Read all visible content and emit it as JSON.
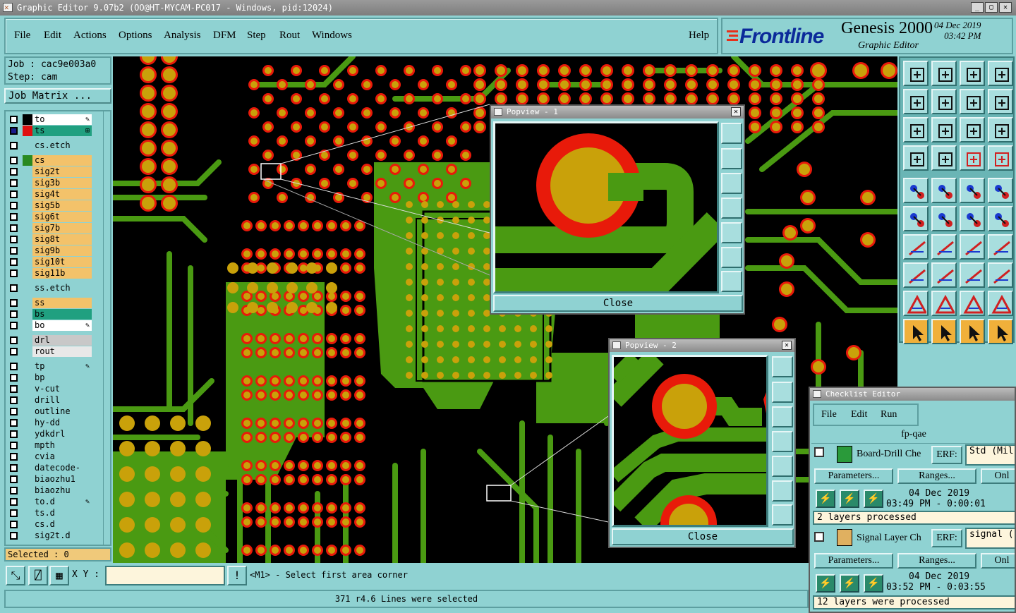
{
  "window": {
    "title": "Graphic Editor 9.07b2 (OO@HT-MYCAM-PC017 - Windows, pid:12024)"
  },
  "menu": [
    "File",
    "Edit",
    "Actions",
    "Options",
    "Analysis",
    "DFM",
    "Step",
    "Rout",
    "Windows"
  ],
  "help": "Help",
  "brand": {
    "logo": "Frontline",
    "product": "Genesis 2000",
    "subtitle": "Graphic Editor",
    "date": "04 Dec 2019",
    "time": "03:42 PM"
  },
  "job": {
    "job": "Job : cac9e003a0",
    "step": "Step: cam",
    "matrix_btn": "Job Matrix ..."
  },
  "layers": [
    {
      "name": "to",
      "color": "#ffffff",
      "swatch": "#000000",
      "mark": "✎"
    },
    {
      "name": "ts",
      "color": "#20a080",
      "swatch": "#e01010",
      "mark": "⊞",
      "checked": true
    },
    {
      "name": "cs.etch",
      "color": "#8fd2d2"
    },
    {
      "name": "cs",
      "color": "#f3c26a",
      "swatch": "#2a8a20"
    },
    {
      "name": "sig2t",
      "color": "#f3c26a"
    },
    {
      "name": "sig3b",
      "color": "#f3c26a"
    },
    {
      "name": "sig4t",
      "color": "#f3c26a"
    },
    {
      "name": "sig5b",
      "color": "#f3c26a"
    },
    {
      "name": "sig6t",
      "color": "#f3c26a"
    },
    {
      "name": "sig7b",
      "color": "#f3c26a"
    },
    {
      "name": "sig8t",
      "color": "#f3c26a"
    },
    {
      "name": "sig9b",
      "color": "#f3c26a"
    },
    {
      "name": "sig10t",
      "color": "#f3c26a"
    },
    {
      "name": "sig11b",
      "color": "#f3c26a"
    },
    {
      "name": "ss.etch",
      "color": "#8fd2d2"
    },
    {
      "name": "ss",
      "color": "#f3c26a"
    },
    {
      "name": "bs",
      "color": "#20a080"
    },
    {
      "name": "bo",
      "color": "#ffffff",
      "mark": "✎"
    },
    {
      "name": "drl",
      "color": "#c8c8c8"
    },
    {
      "name": "rout",
      "color": "#e8e8e8"
    },
    {
      "name": "tp",
      "color": "#8fd2d2",
      "mark": "✎"
    },
    {
      "name": "bp",
      "color": "#8fd2d2"
    },
    {
      "name": "v-cut",
      "color": "#8fd2d2"
    },
    {
      "name": "drill",
      "color": "#8fd2d2"
    },
    {
      "name": "outline",
      "color": "#8fd2d2"
    },
    {
      "name": "hy-dd",
      "color": "#8fd2d2"
    },
    {
      "name": "ydkdrl",
      "color": "#8fd2d2"
    },
    {
      "name": "mpth",
      "color": "#8fd2d2"
    },
    {
      "name": "cvia",
      "color": "#8fd2d2"
    },
    {
      "name": "datecode-pte",
      "color": "#8fd2d2"
    },
    {
      "name": "biaozhu1",
      "color": "#8fd2d2"
    },
    {
      "name": "biaozhu",
      "color": "#8fd2d2"
    },
    {
      "name": "to.d",
      "color": "#8fd2d2",
      "mark": "✎"
    },
    {
      "name": "ts.d",
      "color": "#8fd2d2"
    },
    {
      "name": "cs.d",
      "color": "#8fd2d2"
    },
    {
      "name": "sig2t.d",
      "color": "#8fd2d2"
    }
  ],
  "selected": "Selected : 0",
  "xy_label": "X Y :",
  "xy_value": "",
  "prompt": "<M1> - Select first area corner",
  "status": "371 r4.6 Lines were selected",
  "popview1": {
    "title": "Popview - 1",
    "close": "Close"
  },
  "popview2": {
    "title": "Popview - 2",
    "close": "Close"
  },
  "checklist": {
    "title": "Checklist Editor",
    "menu": [
      "File",
      "Edit",
      "Run"
    ],
    "name": "fp-qae",
    "erf": "ERF:",
    "params": "Parameters...",
    "ranges": "Ranges...",
    "only": "Onl",
    "checks": [
      {
        "name": "Board-Drill Che",
        "erf_value": "Std (Mil",
        "date": "04 Dec 2019",
        "time": "03:49 PM - 0:00:01",
        "result": "2 layers processed"
      },
      {
        "name": "Signal Layer Ch",
        "erf_value": "signal (",
        "date": "04 Dec 2019",
        "time": "03:52 PM - 0:03:55",
        "result": "12 layers were processed"
      }
    ]
  },
  "colors": {
    "background": "#8fd2d2",
    "pcb_copper": "#4a9a12",
    "pad": "#c9a10a",
    "pad_ring": "#e81a0a",
    "canvas": "#000000"
  }
}
